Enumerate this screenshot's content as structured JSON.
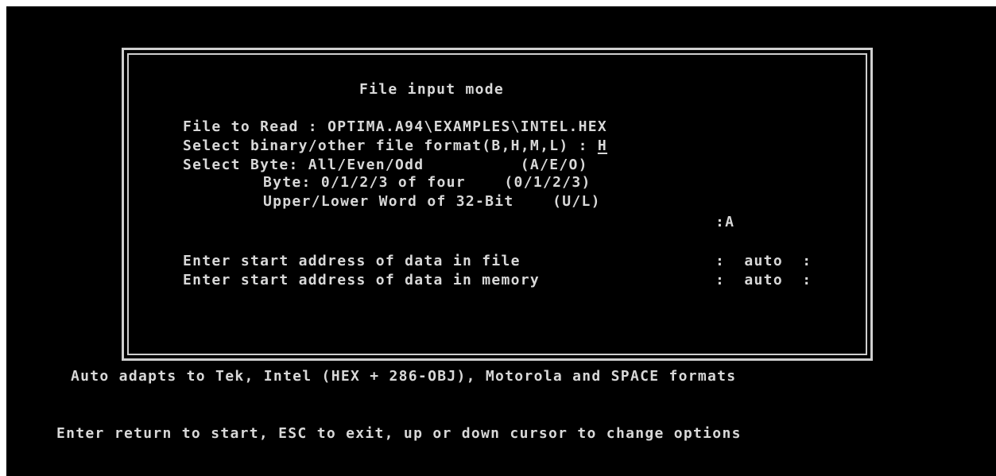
{
  "dialog": {
    "title": "File input mode",
    "file_to_read_label": "File to Read : ",
    "file_to_read_value": "OPTIMA.A94\\EXAMPLES\\INTEL.HEX",
    "format_label": "Select binary/other file format(B,H,M,L) : ",
    "format_value": "H",
    "byte_select_line": "Select Byte: All/Even/Odd          (A/E/O)",
    "byte_quarter_line": "Byte: 0/1/2/3 of four    (0/1/2/3)",
    "word_line": "Upper/Lower Word of 32-Bit    (U/L)",
    "byte_select_value": ":A",
    "start_file_label": "Enter start address of data in file",
    "start_file_value": ":  auto  :",
    "start_memory_label": "Enter start address of data in memory",
    "start_memory_value": ":  auto  :"
  },
  "footer": {
    "formats_note": "Auto adapts to Tek, Intel (HEX + 286-OBJ), Motorola and SPACE formats",
    "instructions": "Enter return to start, ESC to exit, up or down cursor to change options"
  },
  "colors": {
    "background": "#000000",
    "text": "#d8d8d8",
    "frame": "#cfcfcf"
  }
}
